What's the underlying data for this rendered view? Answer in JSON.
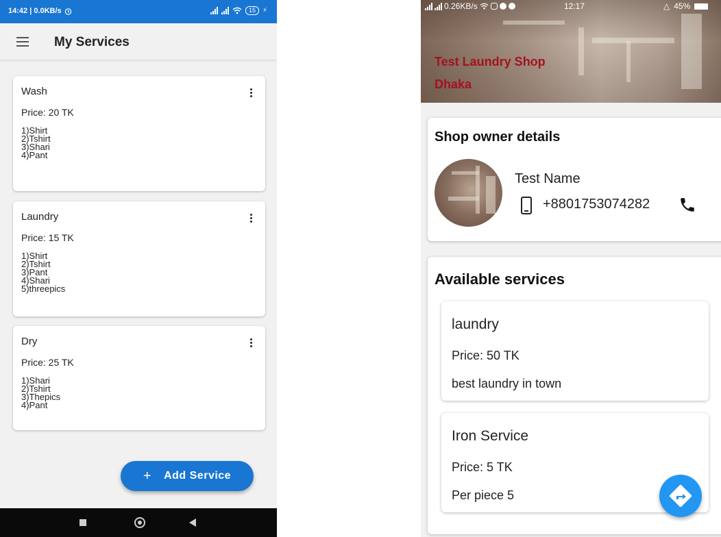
{
  "left_screen": {
    "status_bar": {
      "time_speed": "14:42 | 0.0KB/s",
      "battery": "15"
    },
    "app_bar": {
      "title": "My Services"
    },
    "services": [
      {
        "name": "Wash",
        "price": "Price:  20 TK",
        "items": [
          "1)Shirt",
          "2)Tshirt",
          "3)Shari",
          "4)Pant"
        ]
      },
      {
        "name": "Laundry",
        "price": "Price:  15 TK",
        "items": [
          "1)Shirt",
          "2)Tshirt",
          "3)Pant",
          "4)Shari",
          "5)threepics"
        ]
      },
      {
        "name": "Dry",
        "price": "Price:  25 TK",
        "items": [
          "1)Shari",
          "2)Tshirt",
          "3)Thepics",
          "4)Pant"
        ]
      }
    ],
    "fab": {
      "label": "Add Service",
      "icon": "plus-icon"
    },
    "colors": {
      "primary": "#1976d2",
      "background": "#f1f1f1",
      "nav_bar": "#0a0a0a"
    }
  },
  "right_screen": {
    "status_bar": {
      "speed": "0.26KB/s",
      "time": "12:17",
      "battery": "45%"
    },
    "header": {
      "shop_name": "Test Laundry Shop",
      "city": "Dhaka"
    },
    "owner": {
      "heading": "Shop owner details",
      "name": "Test Name",
      "phone": "+8801753074282",
      "phone_icon": "mobile-phone-icon",
      "call_icon": "call-icon"
    },
    "available_services": {
      "heading": "Available services",
      "items": [
        {
          "name": "laundry",
          "price": "Price:  50 TK",
          "description": "best laundry in town"
        },
        {
          "name": "Iron Service",
          "price": "Price:  5 TK",
          "description": "Per piece 5"
        }
      ]
    },
    "fab": {
      "icon": "directions-icon"
    },
    "colors": {
      "shop_text": "#a4121e",
      "fab": "#2196f3"
    }
  }
}
